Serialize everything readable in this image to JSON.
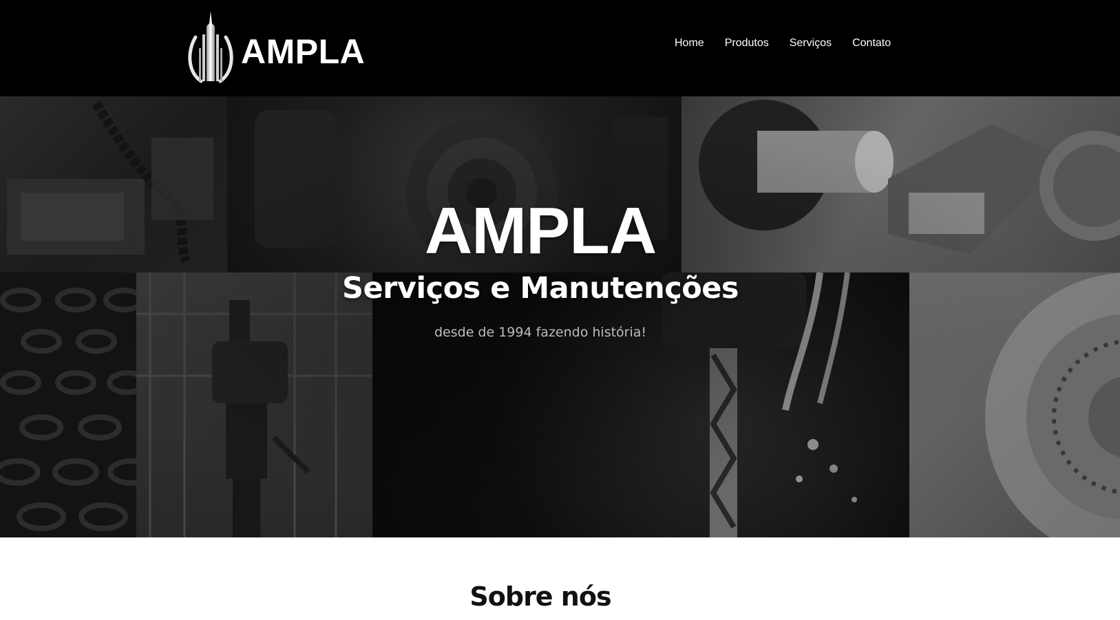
{
  "header": {
    "logo_text": "AMPLA",
    "nav": [
      {
        "label": "Home"
      },
      {
        "label": "Produtos"
      },
      {
        "label": "Serviços"
      },
      {
        "label": "Contato"
      }
    ]
  },
  "hero": {
    "title": "AMPLA",
    "subtitle": "Serviços e Manutenções",
    "tagline": "desde de 1994 fazendo história!"
  },
  "about": {
    "title": "Sobre nós"
  },
  "colors": {
    "header_bg": "#000000",
    "text_light": "#ffffff",
    "tagline": "#bdbdbd",
    "page_bg": "#ffffff",
    "heading_dark": "#111111"
  }
}
